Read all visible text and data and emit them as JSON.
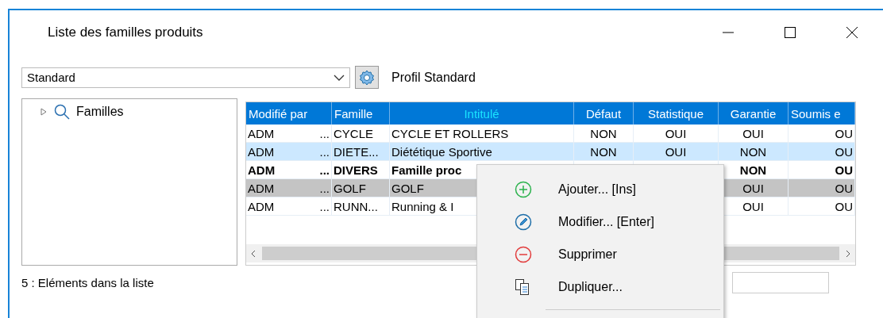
{
  "window": {
    "title": "Liste des familles produits"
  },
  "profile": {
    "value": "Standard",
    "label": "Profil Standard"
  },
  "tree": {
    "items": [
      {
        "label": "Familles",
        "expanded": false
      }
    ]
  },
  "table": {
    "columns": [
      {
        "label": "Modifié par",
        "sorted": false
      },
      {
        "label": "Famille",
        "sorted": false
      },
      {
        "label": "Intitulé",
        "sorted": true
      },
      {
        "label": "Défaut",
        "sorted": false
      },
      {
        "label": "Statistique",
        "sorted": false
      },
      {
        "label": "Garantie",
        "sorted": false
      },
      {
        "label": "Soumis e",
        "sorted": false
      }
    ],
    "rows": [
      {
        "selected": false,
        "hovered": false,
        "bold": false,
        "cells": [
          "ADM",
          "CYCLE",
          "CYCLE ET ROLLERS",
          "NON",
          "OUI",
          "OUI",
          "OU"
        ],
        "more": "..."
      },
      {
        "selected": false,
        "hovered": true,
        "bold": false,
        "cells": [
          "ADM",
          "DIETE...",
          "Diététique Sportive",
          "NON",
          "OUI",
          "NON",
          "OU"
        ],
        "more": "..."
      },
      {
        "selected": false,
        "hovered": false,
        "bold": true,
        "cells": [
          "ADM",
          "DIVERS",
          "Famille proc",
          "",
          "",
          "NON",
          "OU"
        ],
        "more": "..."
      },
      {
        "selected": true,
        "hovered": false,
        "bold": false,
        "cells": [
          "ADM",
          "GOLF",
          "GOLF",
          "",
          "",
          "OUI",
          "OU"
        ],
        "more": "..."
      },
      {
        "selected": false,
        "hovered": false,
        "bold": false,
        "cells": [
          "ADM",
          "RUNN...",
          "Running & I",
          "",
          "",
          "OUI",
          "OU"
        ],
        "more": "..."
      }
    ]
  },
  "status": "5 : Eléments dans la liste",
  "context_menu": {
    "items": [
      {
        "kind": "add",
        "label": "Ajouter... [Ins]"
      },
      {
        "kind": "edit",
        "label": "Modifier... [Enter]"
      },
      {
        "kind": "delete",
        "label": "Supprimer"
      },
      {
        "kind": "duplicate",
        "label": "Dupliquer..."
      }
    ]
  }
}
